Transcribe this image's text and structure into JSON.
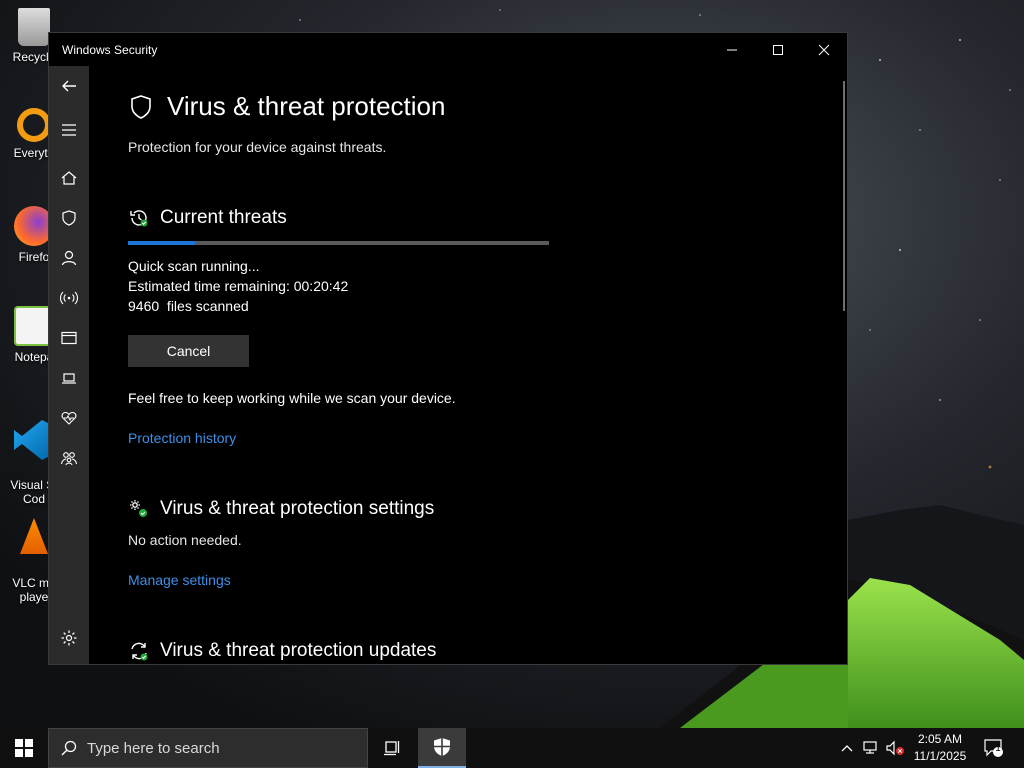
{
  "desktop": {
    "icons": [
      {
        "label": "Recycle"
      },
      {
        "label": "Everyth"
      },
      {
        "label": "Firefo"
      },
      {
        "label": "Notepa"
      },
      {
        "label": "Visual St\nCod"
      },
      {
        "label": "VLC me\nplaye"
      }
    ]
  },
  "window": {
    "title": "Windows Security",
    "heading": "Virus & threat protection",
    "subtitle": "Protection for your device against threats.",
    "current_threats": {
      "heading": "Current threats",
      "progress_fraction": 0.16,
      "status_line": "Quick scan running...",
      "time_remaining": "Estimated time remaining: 00:20:42",
      "files_scanned": "9460  files scanned",
      "cancel_label": "Cancel",
      "note": "Feel free to keep working while we scan your device.",
      "history_link": "Protection history"
    },
    "settings_section": {
      "heading": "Virus & threat protection settings",
      "status": "No action needed.",
      "link": "Manage settings"
    },
    "updates_section": {
      "heading": "Virus & threat protection updates"
    }
  },
  "taskbar": {
    "search_placeholder": "Type here to search",
    "time": "2:05 AM",
    "date": "11/1/2025",
    "notification_count": "1"
  },
  "colors": {
    "accent": "#1f75d6",
    "link": "#3f8fe8",
    "nav_bg": "#2b2b2b",
    "window_bg": "#000000"
  }
}
